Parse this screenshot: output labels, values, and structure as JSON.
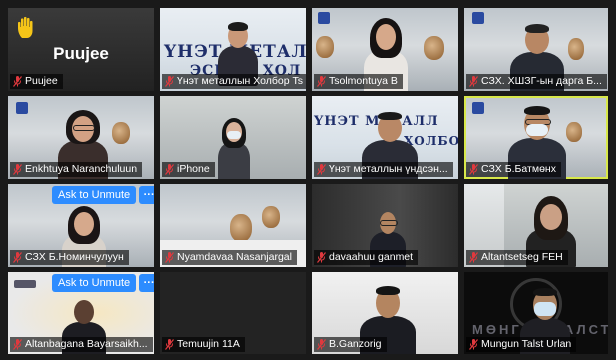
{
  "participants": [
    {
      "name": "Puujee",
      "muted": true,
      "big_name": "Puujee",
      "raised_hand": true
    },
    {
      "name": "Үнэт металлын Холбор Ts...",
      "muted": true,
      "banner": "ҮНЭТ МЕТАЛЛ",
      "banner2": "ЭСНИЙ ХОЛ"
    },
    {
      "name": "Tsolmontuya B",
      "muted": true
    },
    {
      "name": "СЗХ. ХШЗГ-ын дарга Б...",
      "muted": true
    },
    {
      "name": "Enkhtuya Naranchuluun",
      "muted": true
    },
    {
      "name": "iPhone",
      "muted": true
    },
    {
      "name": "Үнэт металлын үндсэн...",
      "muted": true,
      "banner": "ҮНЭТ МЕТАЛЛ",
      "banner2": "ХОЛБОО"
    },
    {
      "name": "СЗХ Б.Батмөнх",
      "muted": true,
      "speaking": true
    },
    {
      "name": "СЗХ Б.Номинчулуун",
      "muted": true,
      "unmute": true
    },
    {
      "name": "Nyamdavaa Nasanjargal",
      "muted": true
    },
    {
      "name": "davaahuu ganmet",
      "muted": true
    },
    {
      "name": "Altantsetseg FEH",
      "muted": true
    },
    {
      "name": "Altanbagana Bayarsaikh...",
      "muted": true,
      "unmute": true
    },
    {
      "name": "Temuujin 11A",
      "muted": true
    },
    {
      "name": "B.Ganzorig",
      "muted": true
    },
    {
      "name": "Mungun Talst Urlan",
      "muted": true,
      "watermark": "МӨНГӨН ТАЛСТ"
    }
  ],
  "controls": {
    "ask_to_unmute": "Ask to Unmute",
    "more": "···"
  },
  "colors": {
    "accent": "#2d8cff",
    "speaking_border": "#d8e84a",
    "muted_icon": "#e0393e"
  },
  "icons": {
    "raised_hand": "raised-hand-icon",
    "muted_mic": "muted-mic-icon"
  }
}
